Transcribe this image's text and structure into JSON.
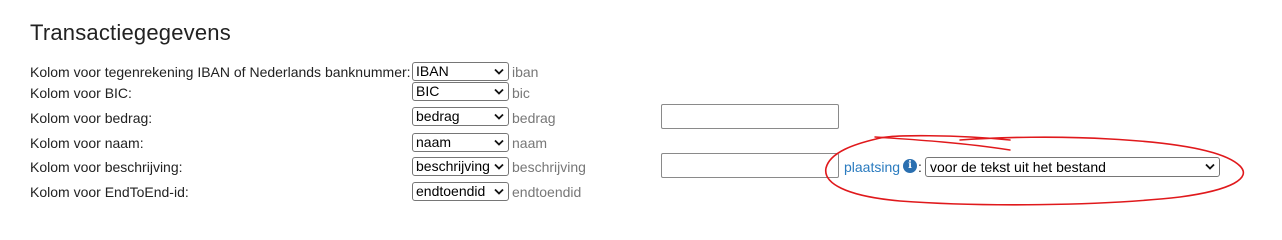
{
  "page_title": "Transactiegegevens",
  "rows": [
    {
      "label": "Kolom voor tegenrekening IBAN of Nederlands banknummer:",
      "select_value": "IBAN",
      "hint": "iban"
    },
    {
      "label": "Kolom voor BIC:",
      "select_value": "BIC",
      "hint": "bic"
    },
    {
      "label": "Kolom voor bedrag:",
      "select_value": "bedrag",
      "hint": "bedrag"
    },
    {
      "label": "Kolom voor naam:",
      "select_value": "naam",
      "hint": "naam"
    },
    {
      "label": "Kolom voor beschrijving:",
      "select_value": "beschrijving",
      "hint": "beschrijving"
    },
    {
      "label": "Kolom voor EndToEnd-id:",
      "select_value": "endtoendid",
      "hint": "endtoendid"
    }
  ],
  "bedrag_input": {
    "value": ""
  },
  "beschrijving_input": {
    "value": ""
  },
  "placement": {
    "link_label": "plaatsing",
    "info_icon_glyph": "i",
    "colon": ":",
    "select_value": "voor de tekst uit het bestand"
  },
  "icons": {
    "info": "info-circle-icon",
    "chevron": "chevron-down-icon"
  },
  "colors": {
    "link": "#2a7bbf",
    "info_icon": "#2a6fb0",
    "annotation": "#e0191c"
  }
}
